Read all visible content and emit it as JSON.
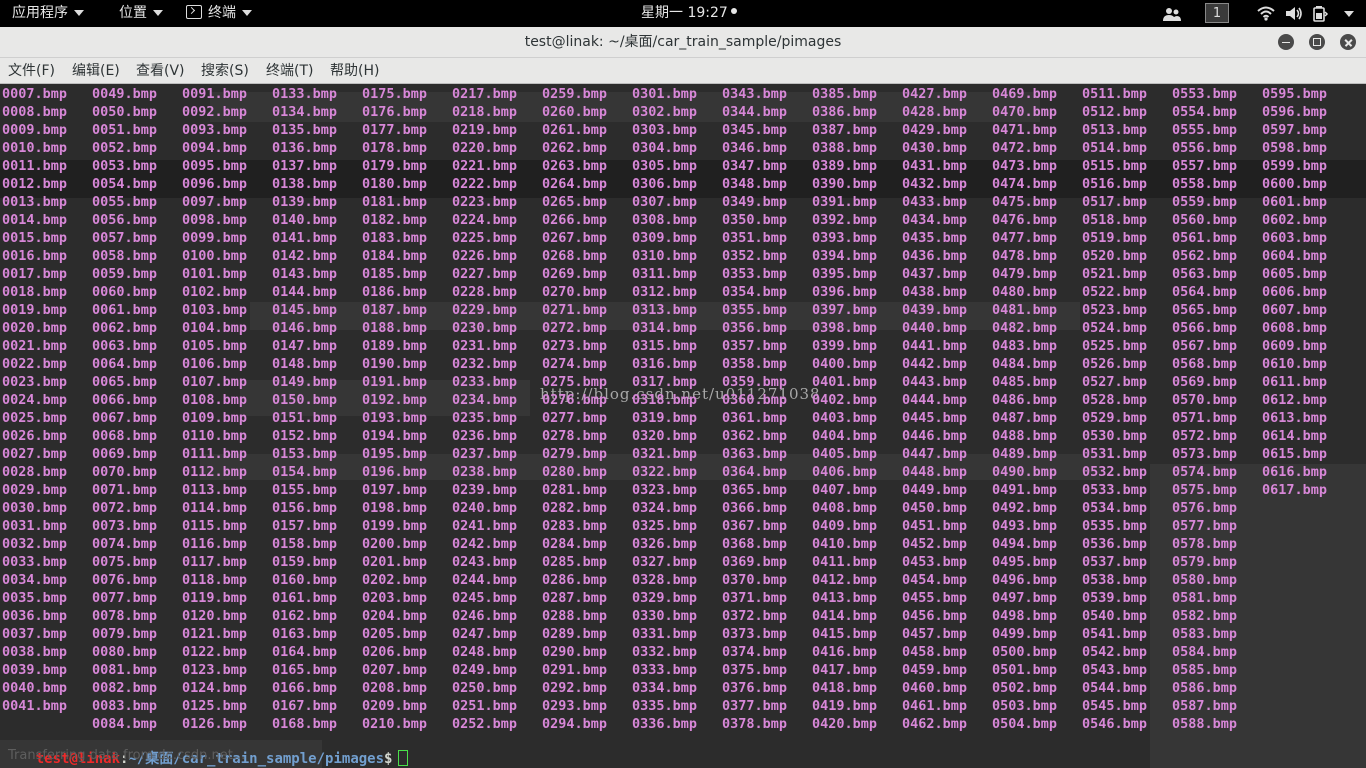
{
  "topbar": {
    "apps_label": "应用程序",
    "places_label": "位置",
    "terminal_label": "终端",
    "clock": "星期一 19:27",
    "workspace": "1",
    "icons": [
      "people-icon",
      "wifi-icon",
      "volume-icon",
      "battery-icon",
      "power-menu-chevron-icon"
    ]
  },
  "window": {
    "title": "test@linak: ~/桌面/car_train_sample/pimages",
    "buttons": [
      "minimize-icon",
      "maximize-icon",
      "close-icon"
    ]
  },
  "menu": [
    "文件(F)",
    "编辑(E)",
    "查看(V)",
    "搜索(S)",
    "终端(T)",
    "帮助(H)"
  ],
  "terminal": {
    "bg_color": "#2c2c2c",
    "file_color": "#d887d8",
    "rows": 35,
    "columns": [
      {
        "start": 7,
        "count": 35
      },
      {
        "start": 49,
        "count": 36
      },
      {
        "start": 91,
        "count": 36
      },
      {
        "start": 133,
        "count": 36
      },
      {
        "start": 175,
        "count": 36
      },
      {
        "start": 217,
        "count": 36
      },
      {
        "start": 259,
        "count": 36
      },
      {
        "start": 301,
        "count": 36
      },
      {
        "start": 343,
        "count": 36
      },
      {
        "start": 385,
        "count": 36
      },
      {
        "start": 427,
        "count": 36
      },
      {
        "start": 469,
        "count": 36
      },
      {
        "start": 511,
        "count": 36
      },
      {
        "start": 553,
        "count": 36
      },
      {
        "start": 595,
        "count": 23
      }
    ],
    "extension": ".bmp",
    "prompt": {
      "user_host": "test@linak",
      "separator": ":",
      "path": "~/桌面/car_train_sample/pimages",
      "symbol": "$"
    },
    "watermark": "http://blog.csdn.net/u011271038",
    "status_text": "Transferring data from dc.csdn.net..."
  }
}
